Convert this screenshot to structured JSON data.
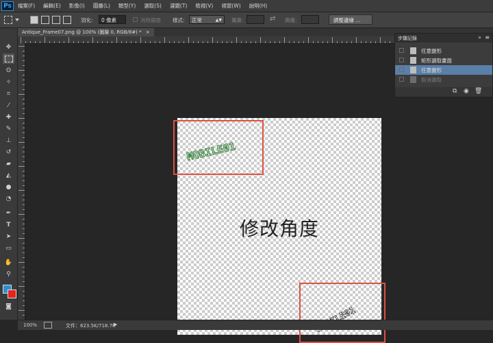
{
  "app": {
    "logo": "Ps"
  },
  "menu": [
    "檔案(F)",
    "編輯(E)",
    "影像(I)",
    "圖層(L)",
    "類型(Y)",
    "選取(S)",
    "濾鏡(T)",
    "檢視(V)",
    "視窗(W)",
    "說明(H)"
  ],
  "options": {
    "feather_label": "羽化:",
    "feather_value": "0 像素",
    "antialias_label": "消除鋸齒",
    "style_label": "樣式:",
    "style_value": "正常",
    "width_label": "寬度:",
    "height_label": "高度:",
    "refine_edge_label": "調整邊緣 ..."
  },
  "document": {
    "tab_title": "Antique_Frame07.png @ 100% (圖層 0, RGB/8#) *",
    "tab_close": "×"
  },
  "canvas": {
    "caption": "修改角度",
    "logo_text": "MOBILE01",
    "rotated_text": "MOBILE01"
  },
  "history_panel": {
    "title": "步驟記錄",
    "items": [
      {
        "label": "任意變形",
        "state": "normal"
      },
      {
        "label": "矩形選取畫面",
        "state": "normal"
      },
      {
        "label": "任意變形",
        "state": "selected"
      },
      {
        "label": "取消選取",
        "state": "dimmed"
      }
    ]
  },
  "status": {
    "zoom": "100%",
    "doc_info": "文件：623.5K/718.7K"
  },
  "colors": {
    "highlight": "#e05040",
    "selected_row": "#5a7fa8",
    "foreground": "#2a8fd4",
    "background": "#e0261e"
  },
  "icons": [
    "marquee-icon",
    "move-icon",
    "lasso-icon",
    "crop-icon",
    "eyedropper-icon",
    "brush-icon",
    "eraser-icon",
    "pen-icon",
    "type-icon",
    "hand-icon",
    "zoom-icon"
  ]
}
